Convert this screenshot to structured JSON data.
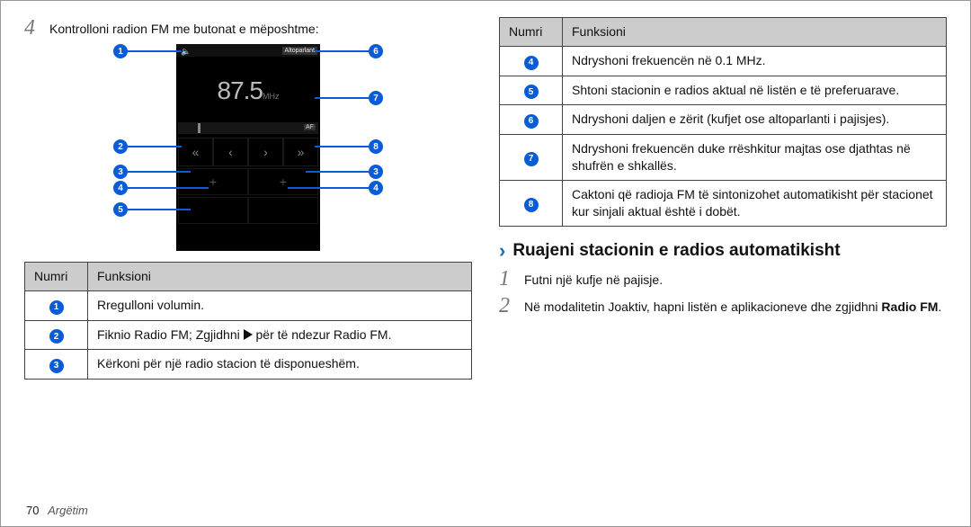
{
  "left": {
    "step4_num": "4",
    "step4_text": "Kontrolloni radion FM me butonat e mëposhtme:",
    "radio": {
      "top_tag": "Altoparlant",
      "freq_big": "87.5",
      "freq_unit": "MHz",
      "af": "AF",
      "ctrl_prev2": "«",
      "ctrl_prev1": "‹",
      "ctrl_next1": "›",
      "ctrl_next2": "»",
      "plus": "+"
    },
    "callouts": {
      "c1": "1",
      "c2": "2",
      "c3": "3",
      "c4": "4",
      "c5": "5",
      "c6": "6",
      "c7": "7",
      "c8": "8"
    },
    "table_header": {
      "num": "Numri",
      "func": "Funksioni"
    },
    "rows": [
      {
        "n": "1",
        "text": "Rregulloni volumin."
      },
      {
        "n": "2",
        "text_a": "Fiknio Radio FM; Zgjidhni ",
        "text_b": " për të ndezur Radio FM."
      },
      {
        "n": "3",
        "text": "Kërkoni për një radio stacion të disponueshëm."
      }
    ]
  },
  "right": {
    "table_header": {
      "num": "Numri",
      "func": "Funksioni"
    },
    "rows": [
      {
        "n": "4",
        "text": "Ndryshoni frekuencën në 0.1 MHz."
      },
      {
        "n": "5",
        "text": "Shtoni stacionin e radios aktual në listën e të preferuarave."
      },
      {
        "n": "6",
        "text": "Ndryshoni daljen e zërit (kufjet ose altoparlanti i pajisjes)."
      },
      {
        "n": "7",
        "text": "Ndryshoni frekuencën duke rrëshkitur majtas ose djathtas në shufrën e shkallës."
      },
      {
        "n": "8",
        "text": "Caktoni që radioja FM të sintonizohet automatikisht për stacionet kur sinjali aktual është i dobët."
      }
    ],
    "section_title": "Ruajeni stacionin e radios automatikisht",
    "step1_num": "1",
    "step1_text": "Futni një kufje në pajisje.",
    "step2_num": "2",
    "step2_text_a": "Në modalitetin Joaktiv, hapni listën e aplikacioneve dhe zgjidhni ",
    "step2_text_b": "Radio FM",
    "step2_text_c": "."
  },
  "footer": {
    "page": "70",
    "section": "Argëtim"
  }
}
